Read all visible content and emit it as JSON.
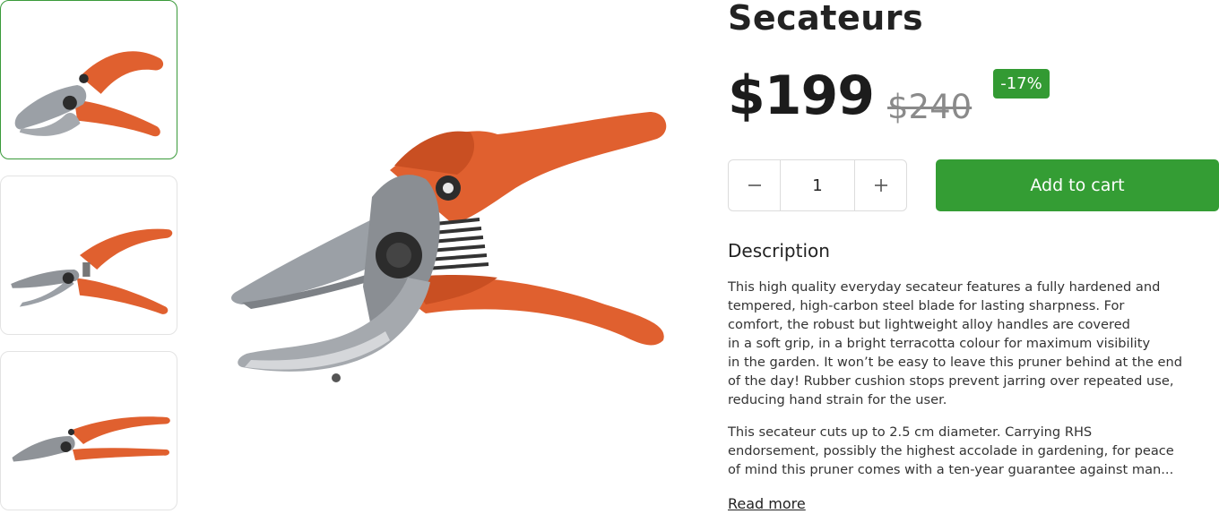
{
  "product": {
    "title": "Secateurs",
    "price": "$199",
    "old_price": "$240",
    "discount_badge": "-17%"
  },
  "purchase": {
    "quantity": "1",
    "add_to_cart_label": "Add to cart",
    "decrement_icon": "minus-icon",
    "increment_icon": "plus-icon"
  },
  "description": {
    "heading": "Description",
    "paragraph1_lines": [
      "This high quality everyday secateur features a fully hardened and",
      "tempered, high-carbon steel blade for lasting sharpness. For",
      "comfort, the robust but lightweight alloy handles are covered",
      "in a soft grip, in a bright terracotta colour for maximum visibility",
      "in the garden. It won’t be easy to leave this pruner behind at the end",
      "of the day! Rubber cushion stops prevent jarring over repeated use,",
      "reducing hand strain for the user."
    ],
    "paragraph2_lines": [
      "This secateur cuts up to 2.5 cm diameter. Carrying RHS",
      "endorsement, possibly the highest accolade in gardening, for peace",
      "of mind this pruner comes with a ten-year guarantee against man..."
    ],
    "read_more": "Read more"
  },
  "gallery": {
    "selected_index": 0,
    "thumbnail_count": 3
  },
  "colors": {
    "accent_green": "#349d34",
    "handle_orange": "#e0602f",
    "blade_grey": "#8f9398"
  }
}
